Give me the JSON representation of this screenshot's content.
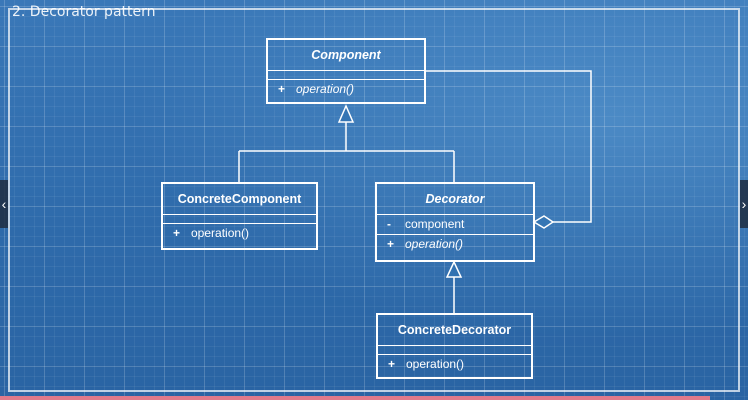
{
  "title": "2. Decorator pattern",
  "classes": {
    "component": {
      "name": "Component",
      "abstract": true,
      "attributes": [],
      "operations": [
        {
          "visibility": "+",
          "name": "operation()",
          "abstract": true
        }
      ]
    },
    "concrete_component": {
      "name": "ConcreteComponent",
      "abstract": false,
      "attributes": [],
      "operations": [
        {
          "visibility": "+",
          "name": "operation()",
          "abstract": false
        }
      ]
    },
    "decorator": {
      "name": "Decorator",
      "abstract": true,
      "attributes": [
        {
          "visibility": "-",
          "name": "component"
        }
      ],
      "operations": [
        {
          "visibility": "+",
          "name": "operation()",
          "abstract": true
        }
      ]
    },
    "concrete_decorator": {
      "name": "ConcreteDecorator",
      "abstract": false,
      "attributes": [],
      "operations": [
        {
          "visibility": "+",
          "name": "operation()",
          "abstract": false
        }
      ]
    }
  },
  "relationships": [
    {
      "type": "generalization",
      "from": "ConcreteComponent",
      "to": "Component"
    },
    {
      "type": "generalization",
      "from": "Decorator",
      "to": "Component"
    },
    {
      "type": "generalization",
      "from": "ConcreteDecorator",
      "to": "Decorator"
    },
    {
      "type": "aggregation",
      "whole": "Decorator",
      "part": "Component"
    }
  ],
  "colors": {
    "background": "#2f6cab",
    "grid": "#ffffff",
    "lines": "#ffffff",
    "progress": "#e07a8a"
  },
  "icons": {
    "prev": "chevron-left-icon",
    "next": "chevron-right-icon"
  }
}
